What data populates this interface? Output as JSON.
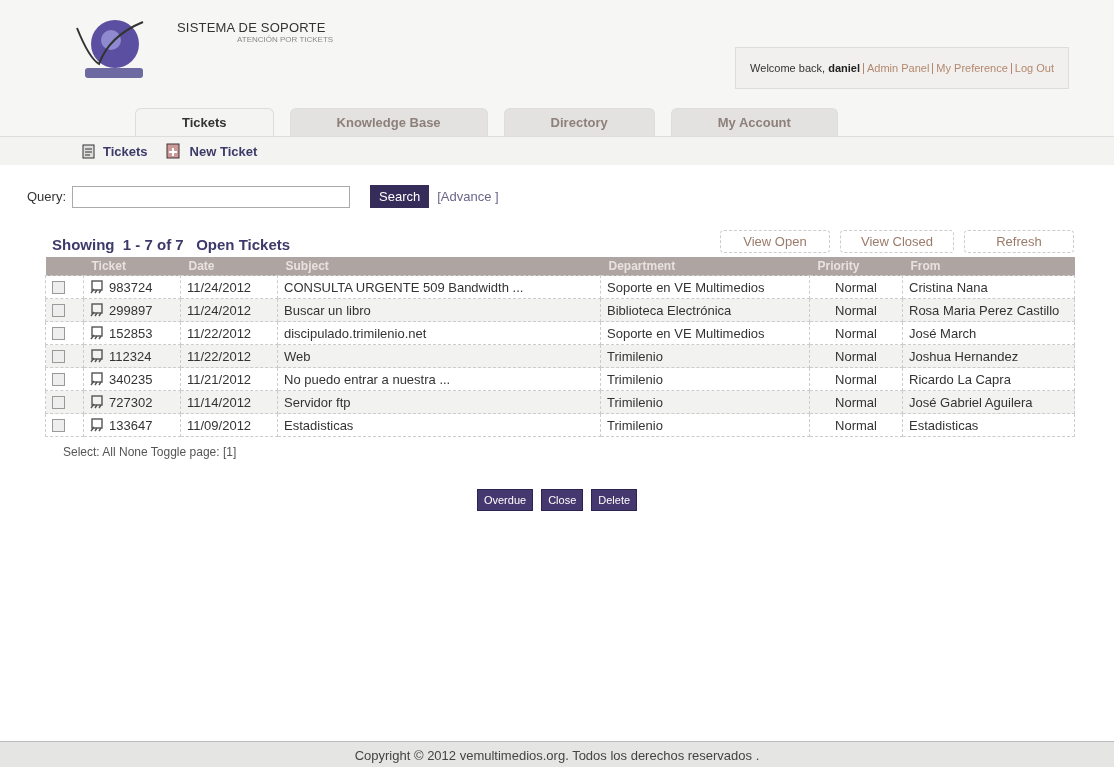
{
  "header": {
    "title": "SISTEMA DE SOPORTE",
    "subtitle": "ATENCIÓN POR TICKETS",
    "welcome": "Welcome back,",
    "user": "daniel",
    "links": [
      "Admin Panel",
      "My Preference",
      "Log Out"
    ]
  },
  "tabs": [
    {
      "label": "Tickets",
      "selected": true
    },
    {
      "label": "Knowledge Base",
      "selected": false
    },
    {
      "label": "Directory",
      "selected": false
    },
    {
      "label": "My Account",
      "selected": false
    }
  ],
  "subnav": [
    {
      "label": "Tickets",
      "kind": "list"
    },
    {
      "label": "New Ticket",
      "kind": "new"
    }
  ],
  "search": {
    "label": "Query:",
    "button": "Search",
    "advanced": "[Advance ]"
  },
  "heading": "Showing  1 - 7 of 7   Open Tickets",
  "view_buttons": [
    "View Open",
    "View Closed",
    "Refresh"
  ],
  "table": {
    "columns": [
      "Ticket",
      "Date",
      "Subject",
      "Department",
      "Priority",
      "From"
    ],
    "rows": [
      {
        "checked": false,
        "ticket": "983724",
        "date": "11/24/2012",
        "subject": "CONSULTA URGENTE 509 Bandwidth ...",
        "department": "Soporte en VE Multimedios",
        "priority": "Normal",
        "from": "Cristina Nana"
      },
      {
        "checked": false,
        "ticket": "299897",
        "date": "11/24/2012",
        "subject": "Buscar un libro",
        "department": "Biblioteca Electrónica",
        "priority": "Normal",
        "from": "Rosa Maria Perez Castillo"
      },
      {
        "checked": false,
        "ticket": "152853",
        "date": "11/22/2012",
        "subject": "discipulado.trimilenio.net",
        "department": "Soporte en VE Multimedios",
        "priority": "Normal",
        "from": "José March"
      },
      {
        "checked": false,
        "ticket": "112324",
        "date": "11/22/2012",
        "subject": "Web",
        "department": "Trimilenio",
        "priority": "Normal",
        "from": "Joshua Hernandez"
      },
      {
        "checked": false,
        "ticket": "340235",
        "date": "11/21/2012",
        "subject": "No puedo entrar a nuestra ...",
        "department": "Trimilenio",
        "priority": "Normal",
        "from": "Ricardo La Capra"
      },
      {
        "checked": false,
        "ticket": "727302",
        "date": "11/14/2012",
        "subject": "Servidor ftp",
        "department": "Trimilenio",
        "priority": "Normal",
        "from": "José Gabriel Aguilera"
      },
      {
        "checked": false,
        "ticket": "133647",
        "date": "11/09/2012",
        "subject": "Estadisticas",
        "department": "Trimilenio",
        "priority": "Normal",
        "from": "Estadisticas"
      }
    ]
  },
  "select_line": "Select: All  None  Toggle  page: [1]",
  "actions": [
    "Overdue",
    "Close",
    "Delete"
  ],
  "footer": "Copyright © 2012 vemultimedios.org.  Todos los derechos reservados ."
}
